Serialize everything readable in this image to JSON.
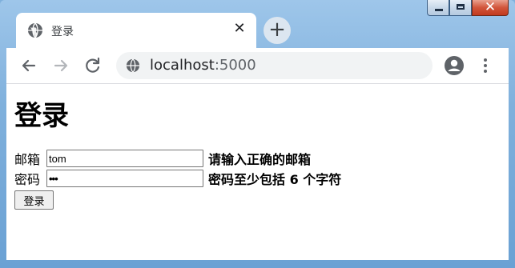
{
  "window": {
    "minimize_icon": "minimize-icon",
    "maximize_icon": "maximize-icon",
    "close_icon": "close-icon",
    "close_color": "#c93d22"
  },
  "tab": {
    "title": "登录",
    "close_glyph": "✕",
    "favicon": "globe-icon"
  },
  "new_tab_glyph": "+",
  "toolbar": {
    "back_icon": "back-arrow-icon",
    "forward_icon": "forward-arrow-icon",
    "reload_icon": "reload-icon",
    "url_host": "localhost",
    "url_port": ":5000",
    "profile_icon": "account-icon",
    "menu_icon": "more-vert-icon"
  },
  "page": {
    "title": "登录",
    "email_label": "邮箱",
    "email_value": "tom",
    "email_error": "请输入正确的邮箱",
    "password_label": "密码",
    "password_value": "•••",
    "password_error": "密码至少包括 6 个字符",
    "submit_label": "登录"
  }
}
